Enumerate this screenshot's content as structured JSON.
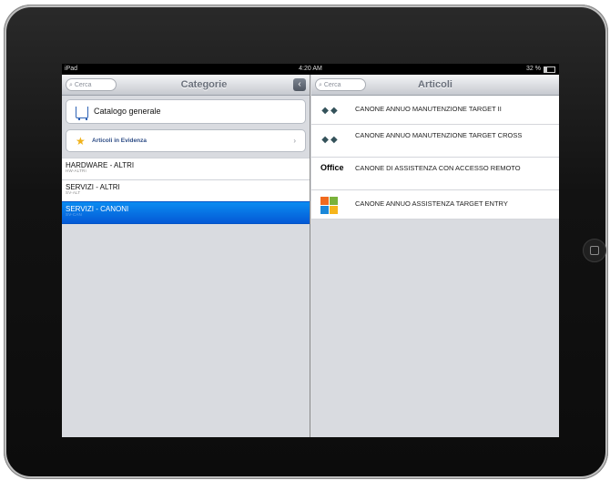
{
  "statusbar": {
    "device": "iPad",
    "time": "4:20 AM",
    "battery": "32 %"
  },
  "left_pane": {
    "search_placeholder": "Cerca",
    "title": "Categorie",
    "collapse_glyph": "‹",
    "catalog_label": "Catalogo generale",
    "featured_label": "Articoli in Evidenza",
    "featured_chevron": "›",
    "categories": [
      {
        "name": "HARDWARE - ALTRI",
        "code": "HW-ALTRI",
        "selected": false
      },
      {
        "name": "SERVIZI - ALTRI",
        "code": "SV-ALT",
        "selected": false
      },
      {
        "name": "SERVIZI - CANONI",
        "code": "SV-CAN",
        "selected": true
      }
    ]
  },
  "right_pane": {
    "search_placeholder": "Cerca",
    "title": "Articoli",
    "articles": [
      {
        "name": "CANONE ANNUO MANUTENZIONE TARGET II",
        "icon": "disc-icon"
      },
      {
        "name": "CANONE ANNUO MANUTENZIONE TARGET CROSS",
        "icon": "disc-icon"
      },
      {
        "name": "CANONE DI ASSISTENZA CON ACCESSO REMOTO",
        "icon": "office-icon",
        "icon_text": "Office"
      },
      {
        "name": "CANONE ANNUO ASSISTENZA TARGET ENTRY",
        "icon": "windows-flag-icon"
      }
    ]
  }
}
